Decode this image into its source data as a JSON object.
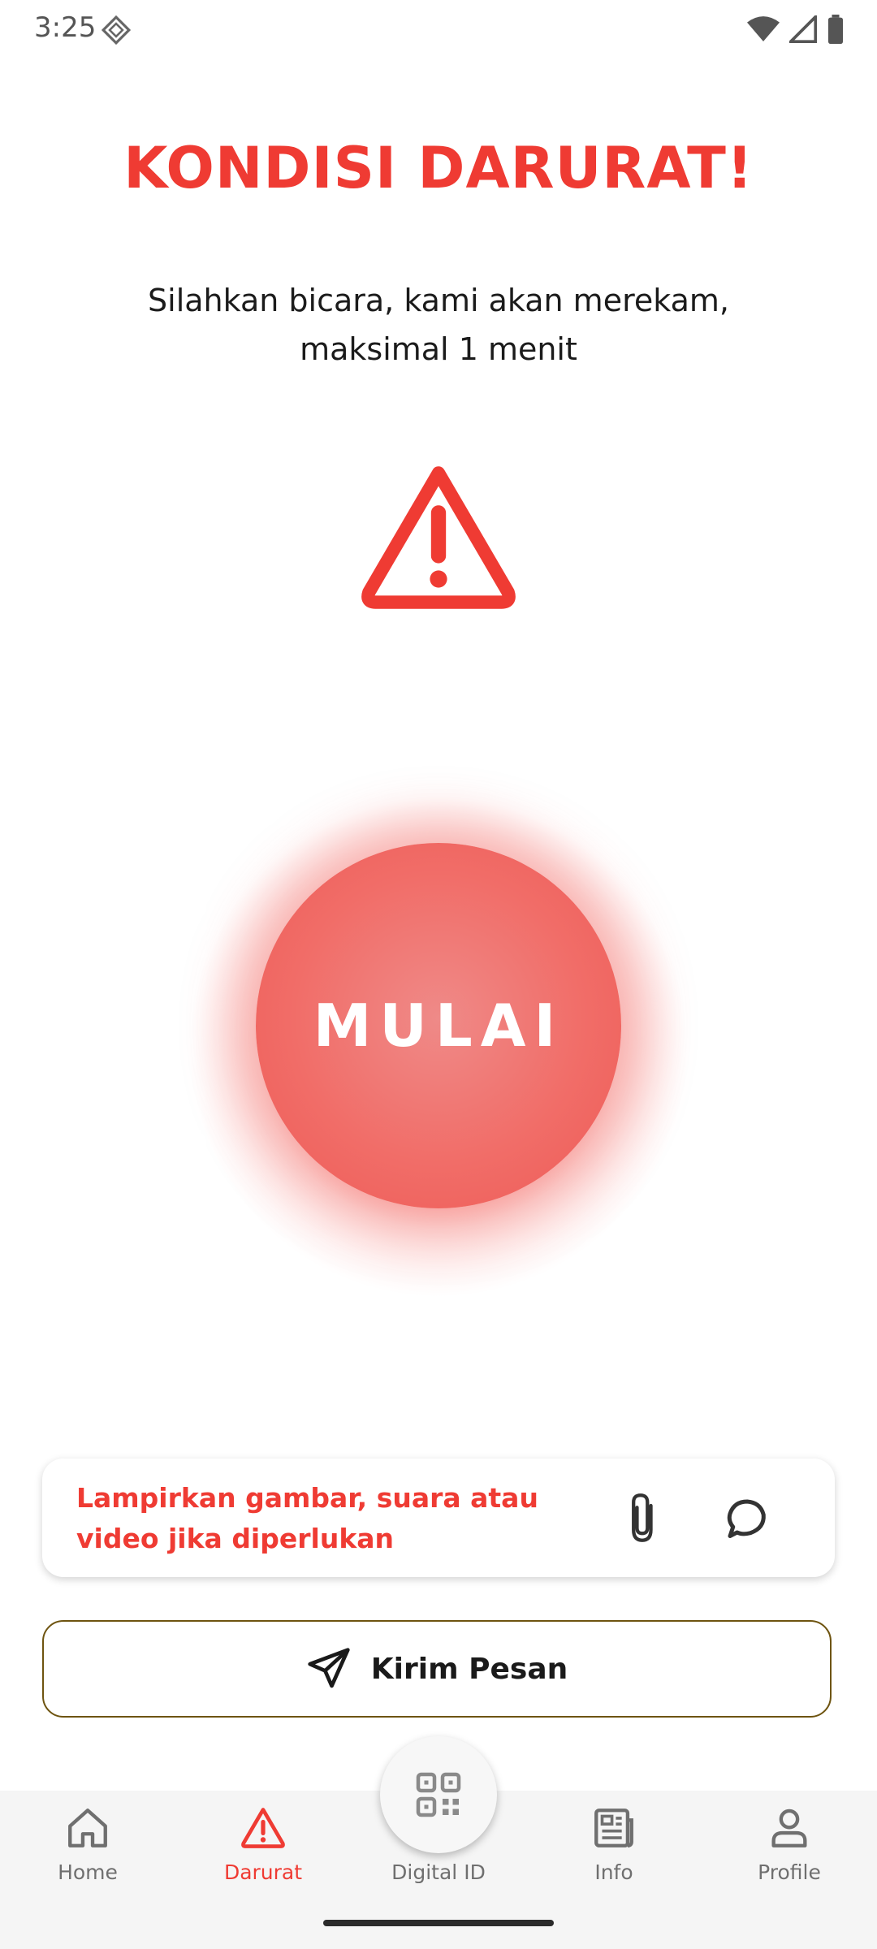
{
  "status_bar": {
    "time": "3:25"
  },
  "emergency": {
    "title": "KONDISI DARURAT!",
    "subtitle": "Silahkan bicara, kami akan merekam, maksimal 1 menit",
    "start_label": "MULAI"
  },
  "attachment": {
    "text": "Lampirkan gambar, suara atau video jika diperlukan"
  },
  "send": {
    "label": "Kirim Pesan"
  },
  "nav": {
    "home": "Home",
    "darurat": "Darurat",
    "digital_id": "Digital ID",
    "info": "Info",
    "profile": "Profile"
  },
  "colors": {
    "accent": "#ef3b33",
    "button": "#f16d68",
    "send_border": "#6e5410"
  }
}
